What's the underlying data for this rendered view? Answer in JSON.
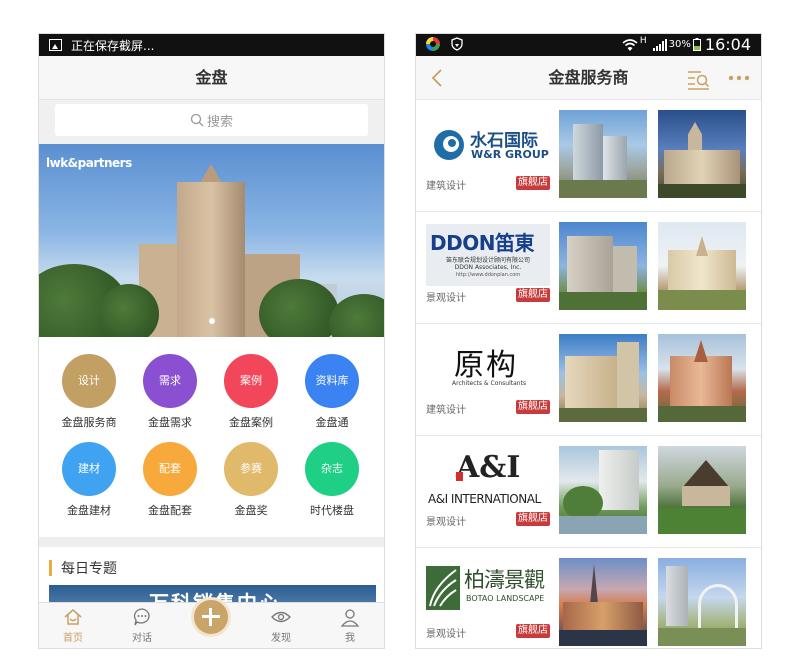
{
  "left_phone": {
    "status_text": "正在保存截屏...",
    "title": "金盘",
    "search_placeholder": "搜索",
    "banner_logo": "lwk&partners",
    "grid": [
      {
        "circle": "设计",
        "label": "金盘服务商",
        "color": "#c29f63"
      },
      {
        "circle": "需求",
        "label": "金盘需求",
        "color": "#8b4fd1"
      },
      {
        "circle": "案例",
        "label": "金盘案例",
        "color": "#f2475a"
      },
      {
        "circle": "资料库",
        "label": "金盘通",
        "color": "#3b82f2"
      },
      {
        "circle": "建材",
        "label": "金盘建材",
        "color": "#3fa3f2"
      },
      {
        "circle": "配套",
        "label": "金盘配套",
        "color": "#f7a93b"
      },
      {
        "circle": "参赛",
        "label": "金盘奖",
        "color": "#e0b96a"
      },
      {
        "circle": "杂志",
        "label": "时代楼盘",
        "color": "#1fcf86"
      }
    ],
    "daily_title": "每日专题",
    "daily_image_text": "万科销售中心",
    "tabs": [
      {
        "label": "首页",
        "icon": "home-icon",
        "active": true
      },
      {
        "label": "对话",
        "icon": "chat-icon",
        "active": false
      },
      {
        "label": "",
        "icon": "plus-icon",
        "active": false
      },
      {
        "label": "发现",
        "icon": "eye-icon",
        "active": false
      },
      {
        "label": "我",
        "icon": "user-icon",
        "active": false
      }
    ],
    "accent_color": "#c8a064"
  },
  "right_phone": {
    "status": {
      "signal_type": "H",
      "battery": "30%",
      "time": "16:04"
    },
    "title": "金盘服务商",
    "providers": [
      {
        "logo_cn": "水石国际",
        "logo_en": "W&R GROUP",
        "category": "建筑设计",
        "badge": "旗舰店"
      },
      {
        "logo_main": "DDON笛東",
        "logo_sub": "笛东联合规划设计顾问有限公司",
        "logo_sub2": "DDON Associates, Inc.",
        "logo_url": "http://www.ddonplan.com",
        "category": "景观设计",
        "badge": "旗舰店"
      },
      {
        "logo_main": "原构",
        "logo_sub": "Architects & Consultants",
        "category": "建筑设计",
        "badge": "旗舰店"
      },
      {
        "logo_main": "A&I",
        "logo_sub": "A&I INTERNATIONAL",
        "category": "景观设计",
        "badge": "旗舰店"
      },
      {
        "logo_main": "柏濤景觀",
        "logo_sub": "BOTAO LANDSCAPE",
        "category": "景观设计",
        "badge": "旗舰店"
      }
    ]
  }
}
